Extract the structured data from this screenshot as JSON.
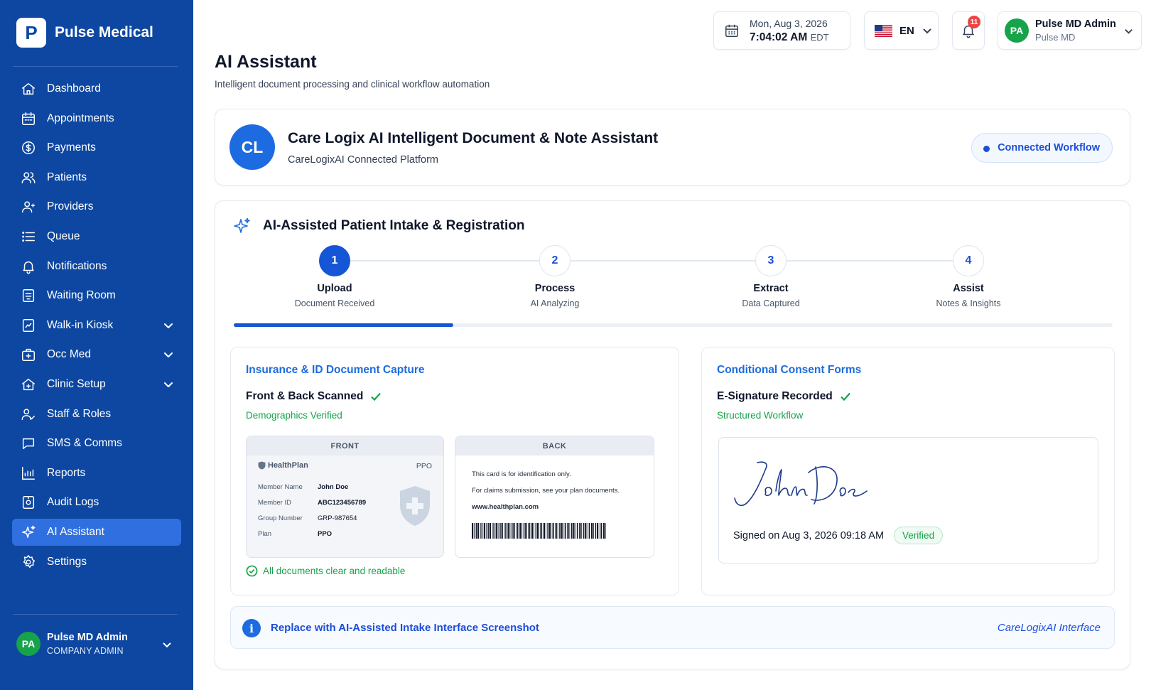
{
  "app": {
    "logo_letter": "P",
    "name": "Pulse Medical"
  },
  "sidebar": {
    "items": [
      {
        "label": "Dashboard",
        "icon": "home-icon"
      },
      {
        "label": "Appointments",
        "icon": "calendar-icon"
      },
      {
        "label": "Payments",
        "icon": "dollar-icon"
      },
      {
        "label": "Patients",
        "icon": "users-icon"
      },
      {
        "label": "Providers",
        "icon": "provider-icon"
      },
      {
        "label": "Queue",
        "icon": "list-icon"
      },
      {
        "label": "Notifications",
        "icon": "bell-icon"
      },
      {
        "label": "Waiting Room",
        "icon": "waiting-room-icon"
      },
      {
        "label": "Walk-in Kiosk",
        "icon": "kiosk-icon",
        "expandable": true
      },
      {
        "label": "Occ Med",
        "icon": "medical-case-icon",
        "expandable": true
      },
      {
        "label": "Clinic Setup",
        "icon": "clinic-icon",
        "expandable": true
      },
      {
        "label": "Staff & Roles",
        "icon": "staff-icon"
      },
      {
        "label": "SMS & Comms",
        "icon": "chat-icon"
      },
      {
        "label": "Reports",
        "icon": "chart-icon"
      },
      {
        "label": "Audit Logs",
        "icon": "audit-icon"
      },
      {
        "label": "AI Assistant",
        "icon": "sparkle-icon",
        "active": true
      },
      {
        "label": "Settings",
        "icon": "gear-icon"
      }
    ],
    "user": {
      "initials": "PA",
      "name": "Pulse MD Admin",
      "role": "COMPANY ADMIN"
    }
  },
  "topbar": {
    "date": "Mon, Aug 3, 2026",
    "time": "7:04:02 AM",
    "tz": "EDT",
    "language": "EN",
    "notification_count": "11",
    "user": {
      "initials": "PA",
      "name": "Pulse MD Admin",
      "org": "Pulse MD"
    }
  },
  "page": {
    "title": "AI Assistant",
    "subtitle": "Intelligent document processing and clinical workflow automation"
  },
  "header_card": {
    "initials": "CL",
    "title": "Care Logix AI Intelligent Document & Note Assistant",
    "subtitle": "CareLogixAI Connected Platform",
    "status": "Connected Workflow"
  },
  "intake": {
    "title": "AI-Assisted Patient Intake & Registration",
    "steps": [
      {
        "num": "1",
        "name": "Upload",
        "desc": "Document Received",
        "done": true
      },
      {
        "num": "2",
        "name": "Process",
        "desc": "AI Analyzing",
        "done": false
      },
      {
        "num": "3",
        "name": "Extract",
        "desc": "Data Captured",
        "done": false
      },
      {
        "num": "4",
        "name": "Assist",
        "desc": "Notes & Insights",
        "done": false
      }
    ],
    "progress_fraction": 0.25,
    "insurance": {
      "title": "Insurance & ID Document Capture",
      "status": "Front & Back Scanned",
      "sub": "Demographics Verified",
      "front": {
        "label": "FRONT",
        "plan_name": "HealthPlan",
        "plan_type": "PPO",
        "rows": [
          {
            "k": "Member Name",
            "v": "John Doe"
          },
          {
            "k": "Member ID",
            "v": "ABC123456789"
          },
          {
            "k": "Group Number",
            "v": "GRP-987654"
          },
          {
            "k": "Plan",
            "v": "PPO"
          }
        ]
      },
      "back": {
        "label": "BACK",
        "line1": "This card is for identification only.",
        "line2": "For claims submission, see your plan documents.",
        "url": "www.healthplan.com"
      },
      "footer": "All documents clear and readable"
    },
    "consent": {
      "title": "Conditional Consent Forms",
      "status": "E-Signature Recorded",
      "sub": "Structured Workflow",
      "signer": "John Doe",
      "signed_on": "Signed on Aug 3, 2026 09:18 AM",
      "verified": "Verified"
    },
    "info_bar": {
      "text": "Replace with AI-Assisted Intake Interface Screenshot",
      "right": "CareLogixAI Interface"
    }
  },
  "colors": {
    "sidebar": "#0d47a1",
    "accent": "#1d6be0",
    "active_nav": "#2f6fe0",
    "success": "#16a34a",
    "badge": "#ef4444"
  }
}
